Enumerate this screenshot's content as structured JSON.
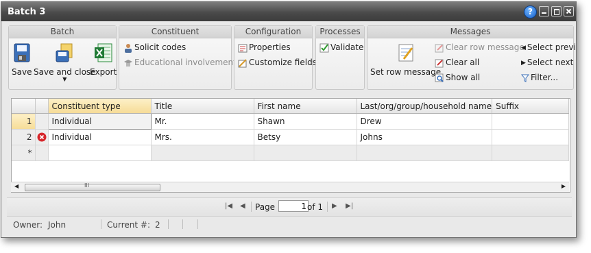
{
  "window": {
    "title": "Batch 3",
    "help_label": "?"
  },
  "ribbon": {
    "groups": {
      "batch": {
        "title": "Batch",
        "save": "Save",
        "save_and_close": "Save and close",
        "export": "Export"
      },
      "constituent": {
        "title": "Constituent",
        "solicit_codes": "Solicit codes",
        "educational_involvements": "Educational involvements"
      },
      "configuration": {
        "title": "Configuration",
        "properties": "Properties",
        "customize_fields": "Customize fields"
      },
      "processes": {
        "title": "Processes",
        "validate": "Validate"
      },
      "messages": {
        "title": "Messages",
        "set_row_message": "Set row message",
        "clear_row_message": "Clear row message",
        "clear_all": "Clear all",
        "show_all": "Show all",
        "select_previous": "Select previ",
        "select_next": "Select next",
        "filter": "Filter..."
      }
    }
  },
  "grid": {
    "columns": [
      "Constituent type",
      "Title",
      "First name",
      "Last/org/group/household name",
      "Suffix"
    ],
    "rows": [
      {
        "num": "1",
        "cells": [
          "Individual",
          "Mr.",
          "Shawn",
          "Drew",
          ""
        ]
      },
      {
        "num": "2",
        "cells": [
          "Individual",
          "Mrs.",
          "Betsy",
          "Johns",
          ""
        ]
      }
    ],
    "new_row_marker": "*",
    "scroll_grip": "III"
  },
  "pager": {
    "page_label": "Page",
    "page_value": "1",
    "of_label": "of 1"
  },
  "status": {
    "owner_label": "Owner:",
    "owner_value": "John",
    "current_label": "Current #:",
    "current_value": "2"
  }
}
